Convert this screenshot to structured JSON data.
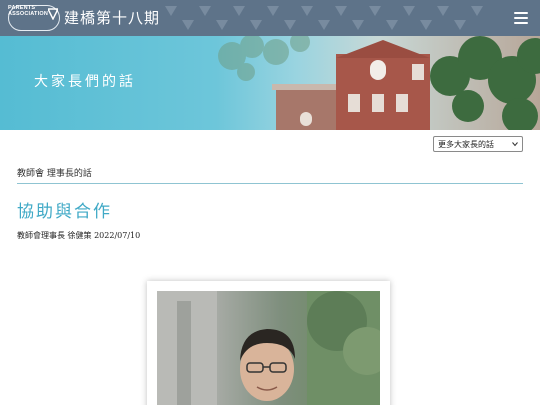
{
  "header": {
    "logo_lines": [
      "PARENTS'",
      "ASSOCIATION"
    ],
    "site_title": "建橋第十八期",
    "menu_icon": "hamburger-icon",
    "bg_color": "#5e7389"
  },
  "banner": {
    "title": "大家長們的話",
    "accent_color": "#55bcd3"
  },
  "more_select": {
    "selected": "更多大家長的話",
    "icon": "chevron-down-icon"
  },
  "breadcrumb": "教師會 理事長的話",
  "article": {
    "title": "協助與合作",
    "byline": "教師會理事長 徐健策 2022/07/10",
    "title_color": "#3fa9c6"
  }
}
